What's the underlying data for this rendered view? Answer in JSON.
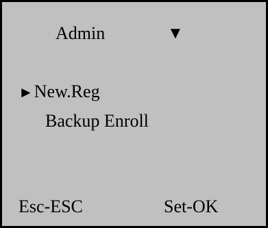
{
  "header": {
    "title": "Admin",
    "dropdown_icon": "▼"
  },
  "menu": {
    "selected_marker": "►",
    "items": [
      {
        "label": "New.Reg",
        "selected": true
      },
      {
        "label": "Backup Enroll",
        "selected": false
      }
    ]
  },
  "softkeys": {
    "left_label": "Esc-ESC",
    "right_label": "Set-OK"
  },
  "colors": {
    "screen_background": "#c0c0c0",
    "border": "#000000",
    "text": "#000000"
  }
}
